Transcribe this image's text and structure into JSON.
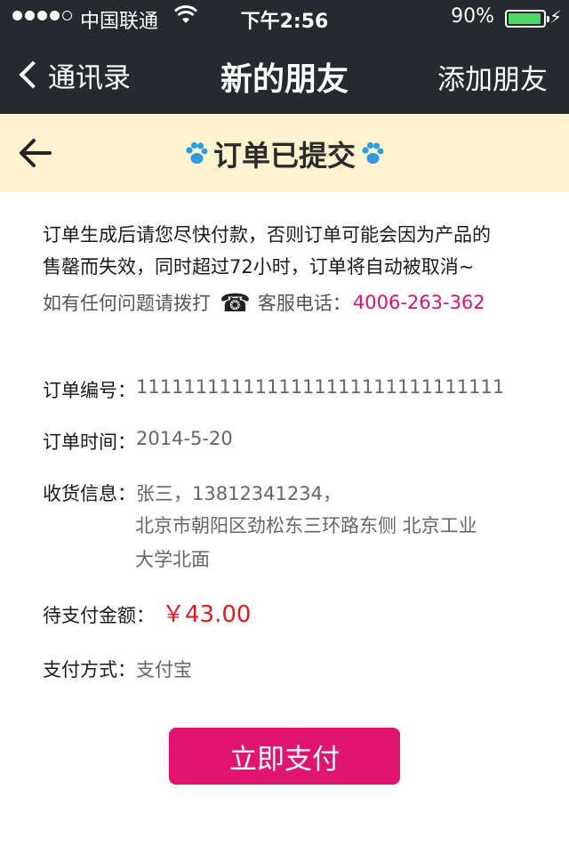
{
  "status_bar": {
    "carrier": "中国联通",
    "time": "下午2:56",
    "battery": "90%",
    "battery_level": 0.9
  },
  "nav": {
    "back_label": "通讯录",
    "title": "新的朋友",
    "right_label": "添加朋友"
  },
  "banner": {
    "title": "订单已提交"
  },
  "notice": {
    "line1": "订单生成后请您尽快付款，否则订单可能会因为产品的",
    "line2": "售罄而失效，同时超过72小时，订单将自动被取消~",
    "contact_prefix": "如有任何问题请拨打",
    "contact_label": "客服电话：",
    "phone": "4006-263-362"
  },
  "order": {
    "id_label": "订单编号：",
    "id_value": "1111111111111111111111111111111",
    "time_label": "订单时间：",
    "time_value": "2014-5-20",
    "receiver_label": "收货信息：",
    "receiver_value": "张三，13812341234，",
    "address_line1": "北京市朝阳区劲松东三环路东侧  北京工业",
    "address_line2": "大学北面",
    "amount_label": "待支付金额：",
    "amount_value": "￥43.00",
    "payment_label": "支付方式：",
    "payment_value": "支付宝"
  },
  "actions": {
    "pay_label": "立即支付"
  },
  "colors": {
    "accent": "#e0156f",
    "phone": "#d8136f",
    "amount": "#d42020",
    "banner_bg": "#fdf3ce",
    "navbar_bg": "#242a2e",
    "paw": "#2f9be0"
  }
}
